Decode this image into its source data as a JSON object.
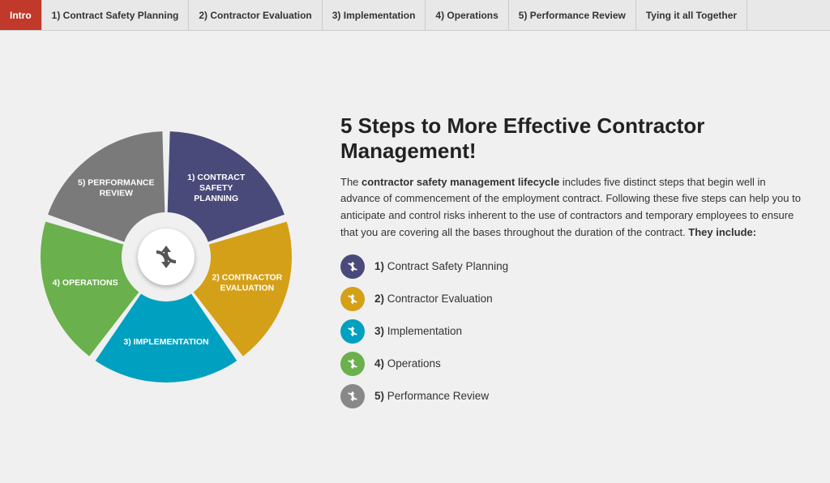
{
  "navbar": {
    "items": [
      {
        "label": "Intro",
        "active": true
      },
      {
        "label": "1) Contract Safety Planning",
        "active": false
      },
      {
        "label": "2) Contractor Evaluation",
        "active": false
      },
      {
        "label": "3) Implementation",
        "active": false
      },
      {
        "label": "4) Operations",
        "active": false
      },
      {
        "label": "5) Performance Review",
        "active": false
      },
      {
        "label": "Tying it all Together",
        "active": false
      }
    ]
  },
  "main": {
    "title": "5 Steps to More Effective Contractor Management!",
    "description_prefix": "The ",
    "description_bold1": "contractor safety management lifecycle",
    "description_middle": " includes five distinct steps that begin well in advance of commencement of the employment contract. Following these five steps can help you to anticipate and control risks inherent to the use of contractors and temporary employees to ensure that you are covering all the bases throughout the duration of the contract. ",
    "description_bold2": "They include:",
    "steps": [
      {
        "number": "1)",
        "label": "Contract Safety Planning",
        "color": "#4a4a7a"
      },
      {
        "number": "2)",
        "label": "Contractor Evaluation",
        "color": "#d4a017"
      },
      {
        "number": "3)",
        "label": "Implementation",
        "color": "#00a0c0"
      },
      {
        "number": "4)",
        "label": "Operations",
        "color": "#6ab04c"
      },
      {
        "number": "5)",
        "label": "Performance Review",
        "color": "#888888"
      }
    ]
  },
  "pie": {
    "segments": [
      {
        "label": "1) CONTRACT\nSAFETY\nPLANNING",
        "color": "#4a4a7a"
      },
      {
        "label": "2) CONTRACTOR\nEVALUATION",
        "color": "#d4a017"
      },
      {
        "label": "3) IMPLEMENTATION",
        "color": "#00a0c0"
      },
      {
        "label": "4) OPERATIONS",
        "color": "#6ab04c"
      },
      {
        "label": "5) PERFORMANCE\nREVIEW",
        "color": "#7a7a7a"
      }
    ]
  }
}
